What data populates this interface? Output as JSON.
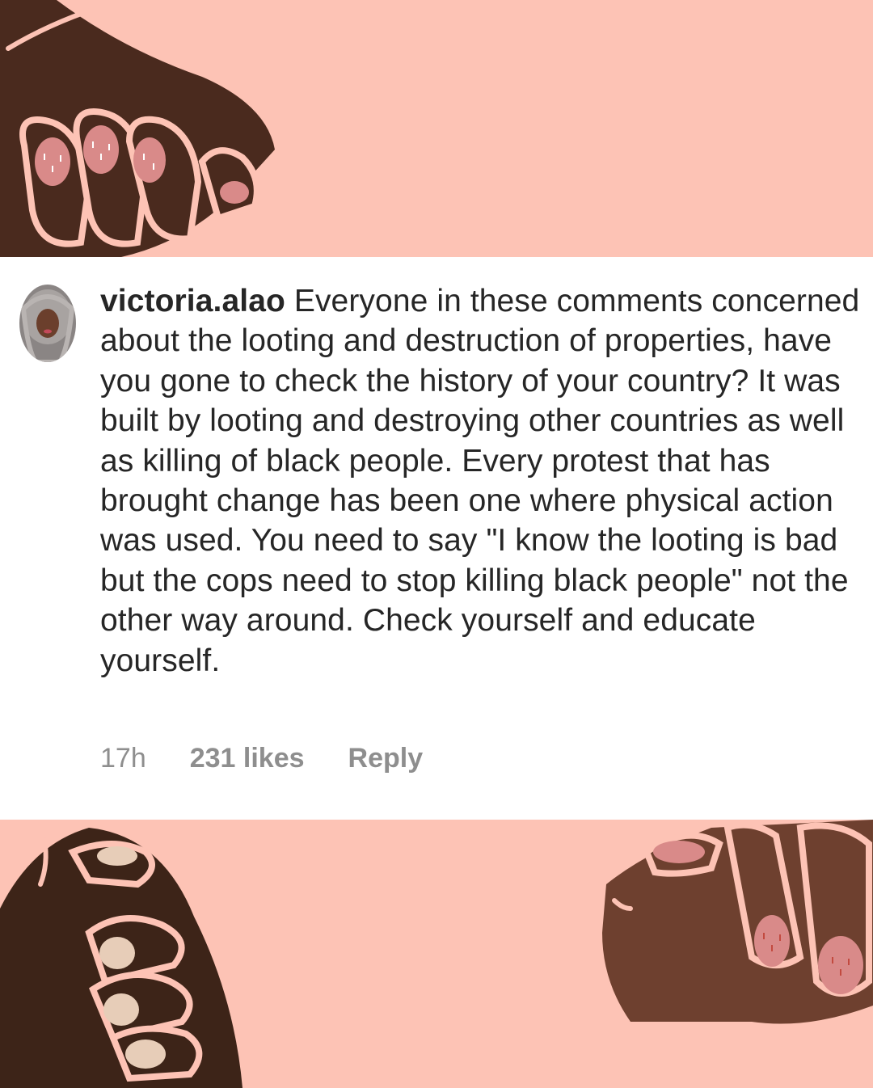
{
  "colors": {
    "background_pink": "#fdc3b5",
    "skin_dark": "#4a2a1e",
    "skin_medium": "#6e402f",
    "nail_pink": "#d98a89",
    "nail_beige": "#e7cdb8",
    "outline": "#fdc3b5",
    "text_primary": "#262626",
    "text_secondary": "#8e8e8e"
  },
  "comment": {
    "username": "victoria.alao",
    "text": " Everyone in these comments concerned about the looting and destruction of properties, have you gone to check the history of your country? It was built by looting and destroying other countries as well as killing of black people. Every protest that has brought change has been one where physical action was used. You need to say \"I know the looting is bad but the cops need to stop killing black people\" not the other way around. Check yourself and educate yourself.",
    "time": "17h",
    "likes": "231 likes",
    "reply": "Reply"
  },
  "decorations": {
    "top_left": "raised-fist-illustration",
    "bottom_left": "raised-fist-illustration",
    "bottom_right": "raised-fist-illustration",
    "avatar": "profile-photo"
  }
}
